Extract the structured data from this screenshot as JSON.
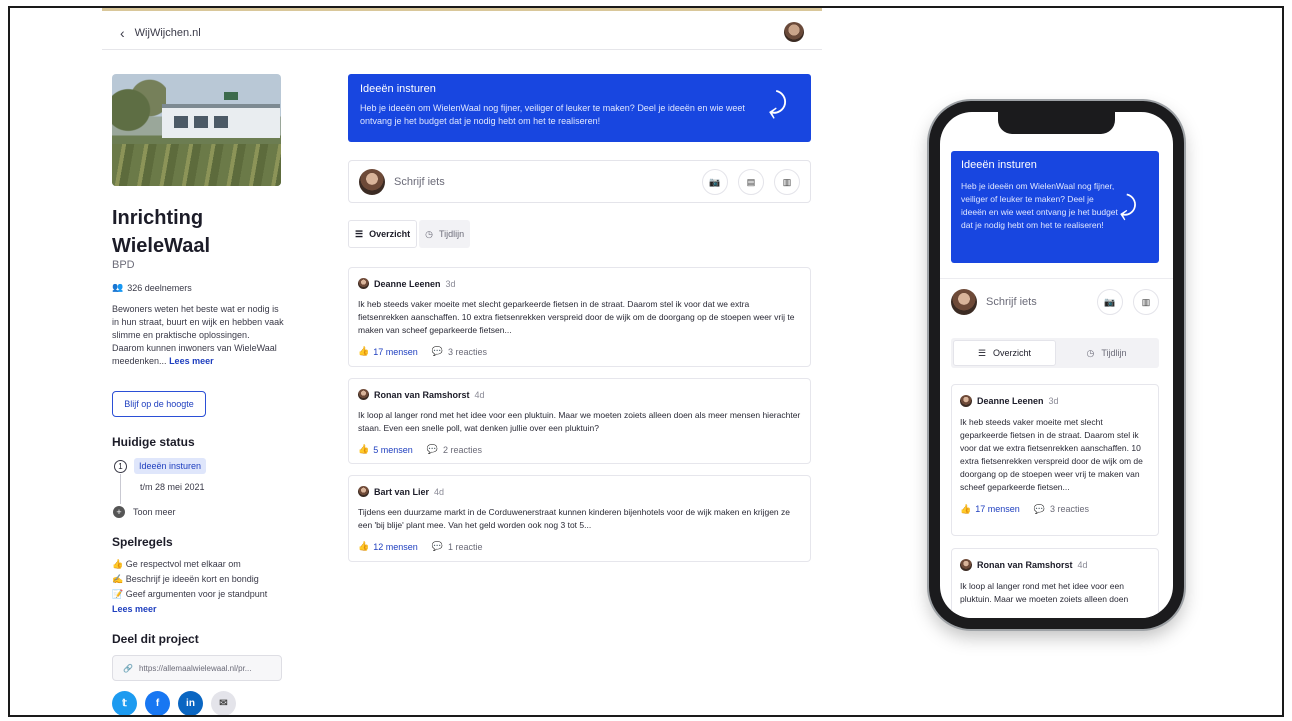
{
  "header": {
    "back_label": "WijWijchen.nl"
  },
  "project": {
    "title": "Inrichting WieleWaal",
    "org": "BPD",
    "members": "326 deelnemers",
    "description": "Bewoners weten het beste wat er nodig is in hun straat, buurt en wijk en hebben vaak slimme en praktische oplossingen. Daarom kunnen inwoners van WieleWaal meedenken...",
    "read_more": "Lees meer",
    "follow_label": "Blijf op de hoogte"
  },
  "status": {
    "heading": "Huidige status",
    "current": "Ideeën insturen",
    "until": "t/m 28 mei 2021",
    "show_more": "Toon meer"
  },
  "rules": {
    "heading": "Spelregels",
    "items": [
      "👍 Ge respectvol met elkaar om",
      "✍️ Beschrijf je ideeën kort en bondig",
      "📝 Geef argumenten voor je standpunt"
    ],
    "read_more": "Lees meer"
  },
  "share": {
    "heading": "Deel dit project",
    "url": "https://allemaalwielewaal.nl/pr...",
    "socials": [
      "twitter",
      "facebook",
      "linkedin",
      "mail"
    ]
  },
  "banner": {
    "title": "Ideeën insturen",
    "text": "Heb je ideeën om WielenWaal nog fijner, veiliger of leuker te maken? Deel je ideeën en wie weet ontvang je het budget dat je nodig hebt om het te realiseren!"
  },
  "composer": {
    "placeholder": "Schrijf iets",
    "icons": [
      "camera-icon",
      "document-icon",
      "poll-icon"
    ]
  },
  "tabs": {
    "overview": "Overzicht",
    "timeline": "Tijdlijn"
  },
  "posts": [
    {
      "author": "Deanne Leenen",
      "ago": "3d",
      "body": "Ik heb steeds vaker moeite met slecht geparkeerde fietsen in de straat. Daarom stel ik voor dat we extra fietsenrekken aanschaffen. 10 extra fietsenrekken verspreid door de wijk om de doorgang op de stoepen weer vrij te maken van scheef geparkeerde fietsen...",
      "likes": "17 mensen",
      "reactions": "3 reacties"
    },
    {
      "author": "Ronan van Ramshorst",
      "ago": "4d",
      "body": "Ik loop al langer rond met het idee voor een pluktuin. Maar we moeten zoiets alleen doen als meer mensen hierachter staan. Even een snelle poll, wat denken jullie over een pluktuin?",
      "likes": "5 mensen",
      "reactions": "2 reacties"
    },
    {
      "author": "Bart van Lier",
      "ago": "4d",
      "body": "Tijdens een duurzame markt in de Corduwenerstraat kunnen kinderen bijenhotels voor de wijk maken en krijgen ze een 'bij blije' plant mee. Van het geld worden ook nog 3 tot 5...",
      "likes": "12 mensen",
      "reactions": "1 reactie"
    }
  ],
  "mobile": {
    "banner_text": "Heb je ideeën om WielenWaal nog fijner, veiliger of leuker te maken? Deel je ideeën en wie weet ontvang je het budget dat je nodig hebt om het te realiseren!",
    "post2_body": "Ik loop al langer rond met het idee voor een pluktuin. Maar we moeten zoiets alleen doen"
  },
  "colors": {
    "accent": "#1846e0",
    "link": "#1f3fbf"
  }
}
